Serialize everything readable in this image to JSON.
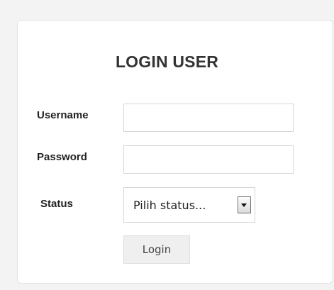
{
  "form": {
    "title": "LOGIN USER",
    "username": {
      "label": "Username",
      "value": "",
      "placeholder": ""
    },
    "password": {
      "label": "Password",
      "value": "",
      "placeholder": ""
    },
    "status": {
      "label": "Status",
      "selected": "Pilih status...",
      "arrow_icon": "chevron-down-icon"
    },
    "submit_label": "Login"
  },
  "colors": {
    "page_background": "#f3f3f3",
    "card_background": "#ffffff",
    "text": "#222222",
    "button_background": "#efefef"
  }
}
